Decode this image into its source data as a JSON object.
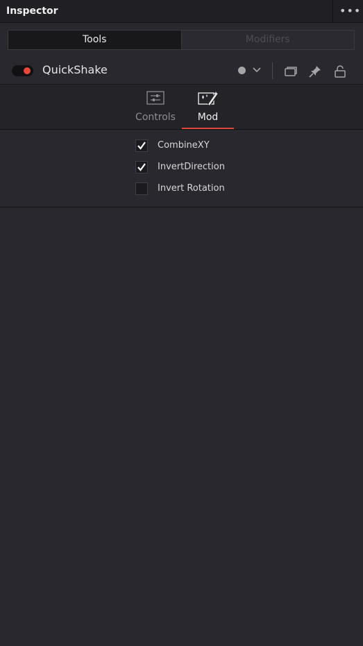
{
  "panel": {
    "title": "Inspector",
    "more_label": "•••"
  },
  "mode_tabs": [
    {
      "label": "Tools",
      "active": true
    },
    {
      "label": "Modifiers",
      "active": false
    }
  ],
  "tool": {
    "name": "QuickShake",
    "enabled": true,
    "toggle_color": "#e8483c"
  },
  "header_icons": [
    "color-dot-icon",
    "chevron-down-icon",
    "versions-icon",
    "pin-icon",
    "lock-icon"
  ],
  "sub_tabs": [
    {
      "label": "Controls",
      "icon": "sliders-icon",
      "active": false
    },
    {
      "label": "Mod",
      "icon": "magic-wand-icon",
      "active": true
    }
  ],
  "checkboxes": [
    {
      "label": "CombineXY",
      "checked": true
    },
    {
      "label": "InvertDirection",
      "checked": true
    },
    {
      "label": "Invert Rotation",
      "checked": false
    }
  ],
  "colors": {
    "accent": "#e0463a",
    "background": "#28282e"
  }
}
